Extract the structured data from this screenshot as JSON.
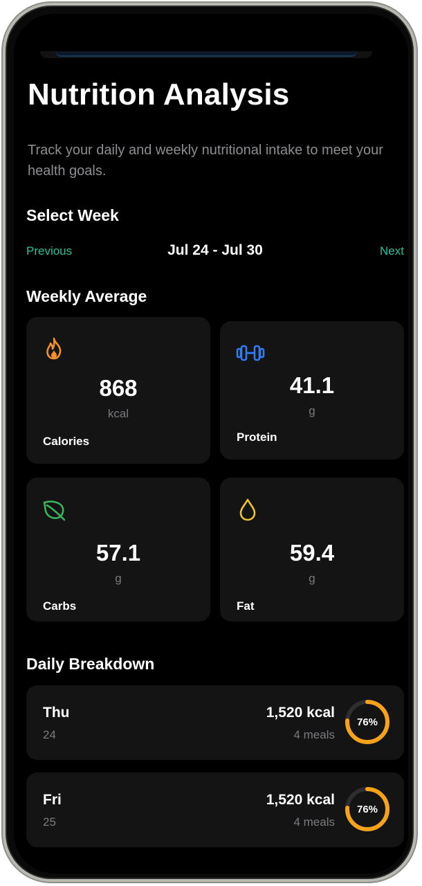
{
  "header": {
    "title": "Nutrition Analysis",
    "subtitle": "Track your daily and weekly nutritional intake to meet your health goals."
  },
  "week_selector": {
    "section_title": "Select Week",
    "previous_label": "Previous",
    "range": "Jul 24 - Jul 30",
    "next_label": "Next"
  },
  "weekly_average": {
    "section_title": "Weekly Average",
    "cards": [
      {
        "icon": "flame-icon",
        "value": "868",
        "unit": "kcal",
        "label": "Calories",
        "color": "#f0922b"
      },
      {
        "icon": "dumbbell-icon",
        "value": "41.1",
        "unit": "g",
        "label": "Protein",
        "color": "#2f7cf6"
      },
      {
        "icon": "leaf-icon",
        "value": "57.1",
        "unit": "g",
        "label": "Carbs",
        "color": "#39b45d"
      },
      {
        "icon": "drop-icon",
        "value": "59.4",
        "unit": "g",
        "label": "Fat",
        "color": "#f2c232"
      }
    ]
  },
  "daily_breakdown": {
    "section_title": "Daily Breakdown",
    "days": [
      {
        "day": "Thu",
        "date": "24",
        "kcal": "1,520 kcal",
        "meals": "4 meals",
        "percent_label": "76%",
        "progress": 0.76
      },
      {
        "day": "Fri",
        "date": "25",
        "kcal": "1,520 kcal",
        "meals": "4 meals",
        "percent_label": "76%",
        "progress": 0.76
      }
    ]
  },
  "colors": {
    "background": "#000000",
    "card": "#141414",
    "accent_green": "#27c09d",
    "ring_orange": "#f7a21b",
    "ring_track": "#2e2e2e",
    "muted_text": "#7b7b80"
  }
}
